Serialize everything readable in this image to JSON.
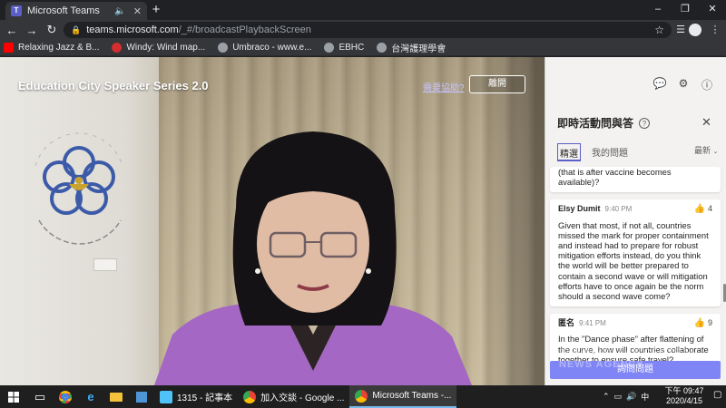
{
  "browser": {
    "tab_title": "Microsoft Teams",
    "url_host": "teams.microsoft.com",
    "url_path": "/_#/broadcastPlaybackScreen",
    "bookmarks": [
      {
        "label": "Relaxing Jazz & B...",
        "icon": "youtube-icon",
        "color": "#ff0000"
      },
      {
        "label": "Windy: Wind map...",
        "icon": "windy-icon",
        "color": "#d32f2f"
      },
      {
        "label": "Umbraco - www.e...",
        "icon": "globe-icon",
        "color": "#9aa0a6"
      },
      {
        "label": "EBHC",
        "icon": "globe-icon",
        "color": "#9aa0a6"
      },
      {
        "label": "台灣護理學會",
        "icon": "globe-icon",
        "color": "#9aa0a6"
      }
    ]
  },
  "stage": {
    "title": "Education City Speaker Series 2.0",
    "help_link": "需要協助?",
    "leave_button": "離開",
    "watermark": "中央通訊社 THE CENTRAL NEWS AGENCY"
  },
  "qa": {
    "title": "即時活動問與答",
    "tabs": [
      "精選",
      "我的問題"
    ],
    "sort_label": "最新",
    "questions": [
      {
        "author": "",
        "time": "",
        "likes": "",
        "text": "(that is after vaccine becomes available)?"
      },
      {
        "author": "Elsy Dumit",
        "time": "9:40 PM",
        "likes": "4",
        "text": "Given that most, if not all, countries missed the mark for proper containment and instead had to prepare for robust mitigation efforts instead, do you think the world will be better prepared to contain a second wave or will mitigation efforts have to once again be the norm should a second wave come?"
      },
      {
        "author": "匿名",
        "time": "9:41 PM",
        "likes": "9",
        "text": "In the \"Dance phase\" after flattening of the curve, how will countries collaborate together to ensure safe travel?"
      }
    ],
    "ask_button": "詢問問題"
  },
  "taskbar": {
    "apps": [
      {
        "label": "1315 - 記事本",
        "active": false,
        "color": "#4fc3f7"
      },
      {
        "label": "加入交談 - Google ...",
        "active": false,
        "color": "#fbbc05"
      },
      {
        "label": "Microsoft Teams -...",
        "active": true,
        "color": "#fbbc05"
      }
    ],
    "time": "下午 09:47",
    "date": "2020/4/15"
  }
}
